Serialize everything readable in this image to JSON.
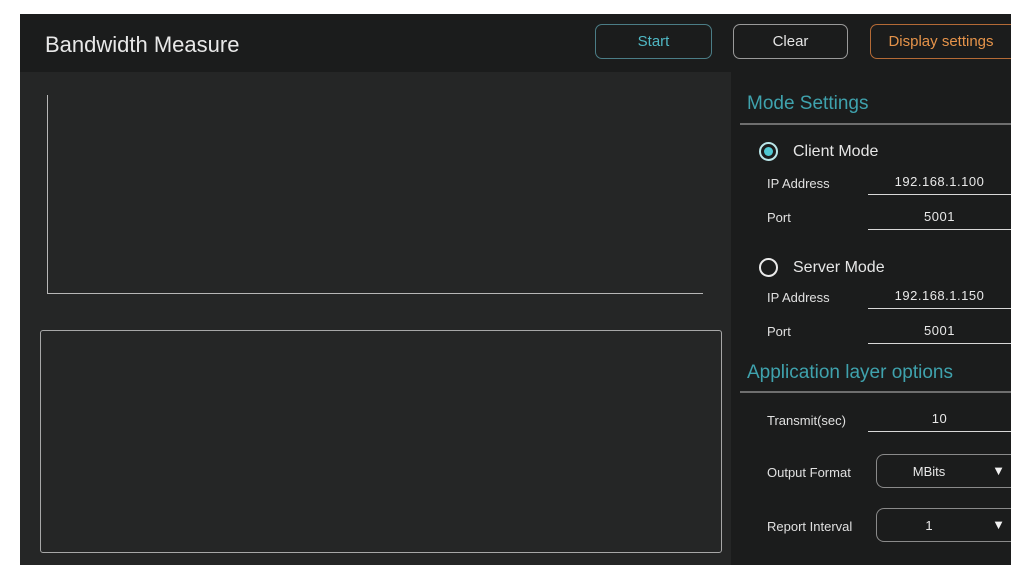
{
  "header": {
    "title": "Bandwidth Measure",
    "buttons": {
      "start": "Start",
      "clear": "Clear",
      "display_settings": "Display settings"
    }
  },
  "mode_settings": {
    "title": "Mode Settings",
    "selected_mode": "client",
    "client": {
      "label": "Client Mode",
      "ip_label": "IP Address",
      "ip_value": "192.168.1.100",
      "port_label": "Port",
      "port_value": "5001"
    },
    "server": {
      "label": "Server Mode",
      "ip_label": "IP Address",
      "ip_value": "192.168.1.150",
      "port_label": "Port",
      "port_value": "5001"
    }
  },
  "app_options": {
    "title": "Application layer options",
    "transmit_label": "Transmit(sec)",
    "transmit_value": "10",
    "output_format_label": "Output Format",
    "output_format_value": "MBits",
    "report_interval_label": "Report Interval",
    "report_interval_value": "1"
  },
  "icons": {
    "dropdown": "▼"
  },
  "colors": {
    "accent_teal": "#3fa2ad",
    "accent_orange": "#e5934a",
    "background": "#252626",
    "panel": "#1b1c1c"
  }
}
